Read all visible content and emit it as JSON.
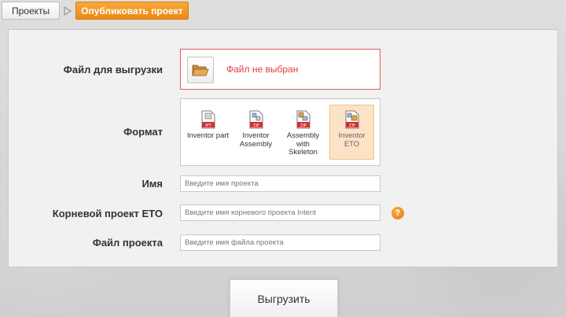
{
  "breadcrumb": {
    "projects_label": "Проекты",
    "publish_label": "Опубликовать проект"
  },
  "colors": {
    "accent_orange": "#ea8a12",
    "error_red": "#e03c3c",
    "selected_bg": "#fde3c6"
  },
  "form": {
    "file_label": "Файл для выгрузки",
    "file_status": "Файл не выбран",
    "format_label": "Формат",
    "formats": [
      {
        "label": "Inventor part",
        "badge": "IPT",
        "selected": false,
        "icon": "inventor-part-icon"
      },
      {
        "label": "Inventor Assembly",
        "badge": "ZIP",
        "selected": false,
        "icon": "inventor-assembly-icon"
      },
      {
        "label": "Assembly with Skeleton",
        "badge": "ZIP",
        "selected": false,
        "icon": "assembly-skeleton-icon"
      },
      {
        "label": "Inventor ETO",
        "badge": "ZIP",
        "selected": true,
        "icon": "inventor-eto-icon"
      }
    ],
    "name_label": "Имя",
    "name_placeholder": "Введите имя проекта",
    "root_label": "Корневой проект ETO",
    "root_placeholder": "Введите имя корневого проекта Intent",
    "help_glyph": "?",
    "project_file_label": "Файл проекта",
    "project_file_placeholder": "Введите имя файла проекта"
  },
  "submit_label": "Выгрузить"
}
